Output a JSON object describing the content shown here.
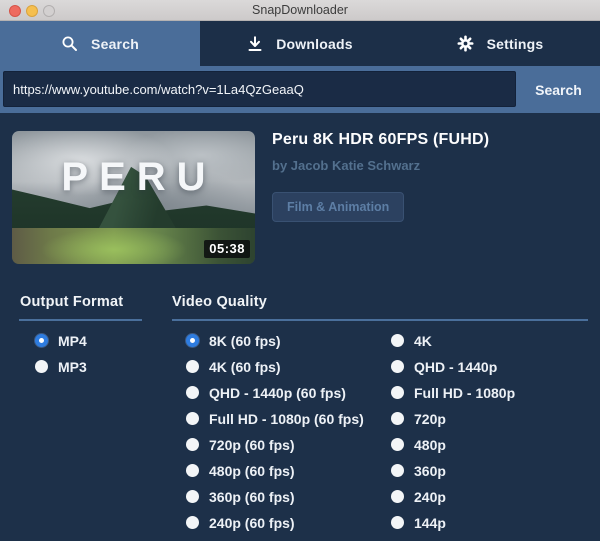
{
  "window": {
    "title": "SnapDownloader"
  },
  "tabs": [
    {
      "label": "Search",
      "icon": "search-icon",
      "active": true
    },
    {
      "label": "Downloads",
      "icon": "download-icon",
      "active": false
    },
    {
      "label": "Settings",
      "icon": "gear-icon",
      "active": false
    }
  ],
  "search_bar": {
    "url_value": "https://www.youtube.com/watch?v=1La4QzGeaaQ",
    "button_label": "Search"
  },
  "video": {
    "title": "Peru 8K HDR 60FPS (FUHD)",
    "byline": "by Jacob Katie Schwarz",
    "category": "Film & Animation",
    "duration": "05:38",
    "thumbnail_caption": "PERU"
  },
  "output_format": {
    "heading": "Output Format",
    "options": [
      {
        "label": "MP4",
        "selected": true
      },
      {
        "label": "MP3",
        "selected": false
      }
    ]
  },
  "video_quality": {
    "heading": "Video Quality",
    "column_left": [
      {
        "label": "8K (60 fps)",
        "selected": true
      },
      {
        "label": "4K (60 fps)",
        "selected": false
      },
      {
        "label": "QHD - 1440p (60 fps)",
        "selected": false
      },
      {
        "label": "Full HD - 1080p (60 fps)",
        "selected": false
      },
      {
        "label": "720p (60 fps)",
        "selected": false
      },
      {
        "label": "480p (60 fps)",
        "selected": false
      },
      {
        "label": "360p (60 fps)",
        "selected": false
      },
      {
        "label": "240p (60 fps)",
        "selected": false
      }
    ],
    "column_right": [
      {
        "label": "4K",
        "selected": false
      },
      {
        "label": "QHD - 1440p",
        "selected": false
      },
      {
        "label": "Full HD - 1080p",
        "selected": false
      },
      {
        "label": "720p",
        "selected": false
      },
      {
        "label": "480p",
        "selected": false
      },
      {
        "label": "360p",
        "selected": false
      },
      {
        "label": "240p",
        "selected": false
      },
      {
        "label": "144p",
        "selected": false
      }
    ]
  },
  "colors": {
    "navy": "#1d3049",
    "tabbar_dark": "#1c2f48",
    "accent_blue": "#4a6d99",
    "radio_selected_blue": "#2e7ce0",
    "underline_blue": "#4a6f9b",
    "byline_text": "#53708e"
  }
}
